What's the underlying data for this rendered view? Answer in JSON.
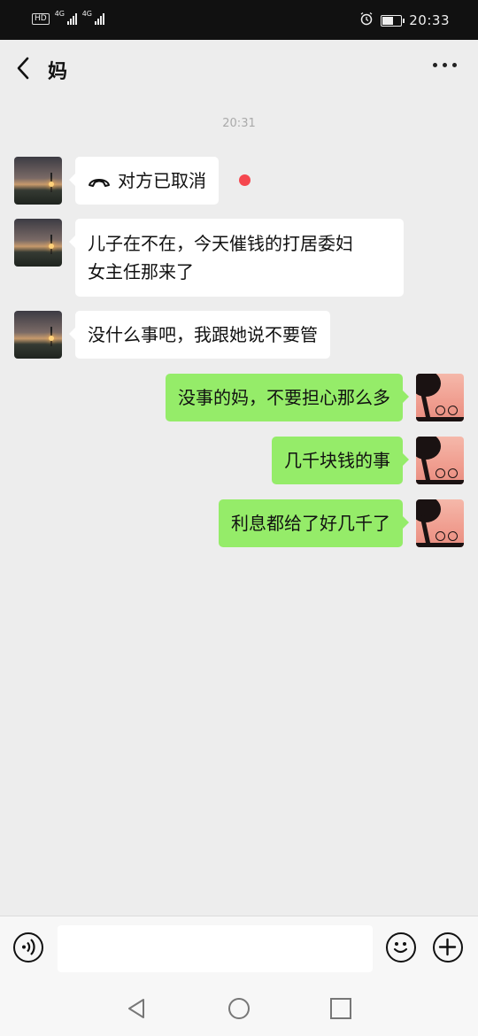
{
  "status_bar": {
    "hd_label": "HD",
    "network1": "4G",
    "network2": "4G",
    "battery_level": 0.55,
    "time": "20:33"
  },
  "header": {
    "title": "妈"
  },
  "timestamp": "20:31",
  "messages": [
    {
      "side": "left",
      "text": "对方已取消",
      "type": "call"
    },
    {
      "side": "left",
      "text": "儿子在不在，今天催钱的打居委妇女主任那来了",
      "line1": "儿子在不在，今天催钱的打居委妇",
      "line2": "女主任那来了"
    },
    {
      "side": "left",
      "text": "没什么事吧，我跟她说不要管"
    },
    {
      "side": "right",
      "text": "没事的妈，不要担心那么多"
    },
    {
      "side": "right",
      "text": "几千块钱的事"
    },
    {
      "side": "right",
      "text": "利息都给了好几千了"
    }
  ],
  "input": {
    "value": "",
    "placeholder": ""
  },
  "colors": {
    "bubble_mine": "#95ec69",
    "unread": "#f5474f",
    "background": "#ededed"
  }
}
